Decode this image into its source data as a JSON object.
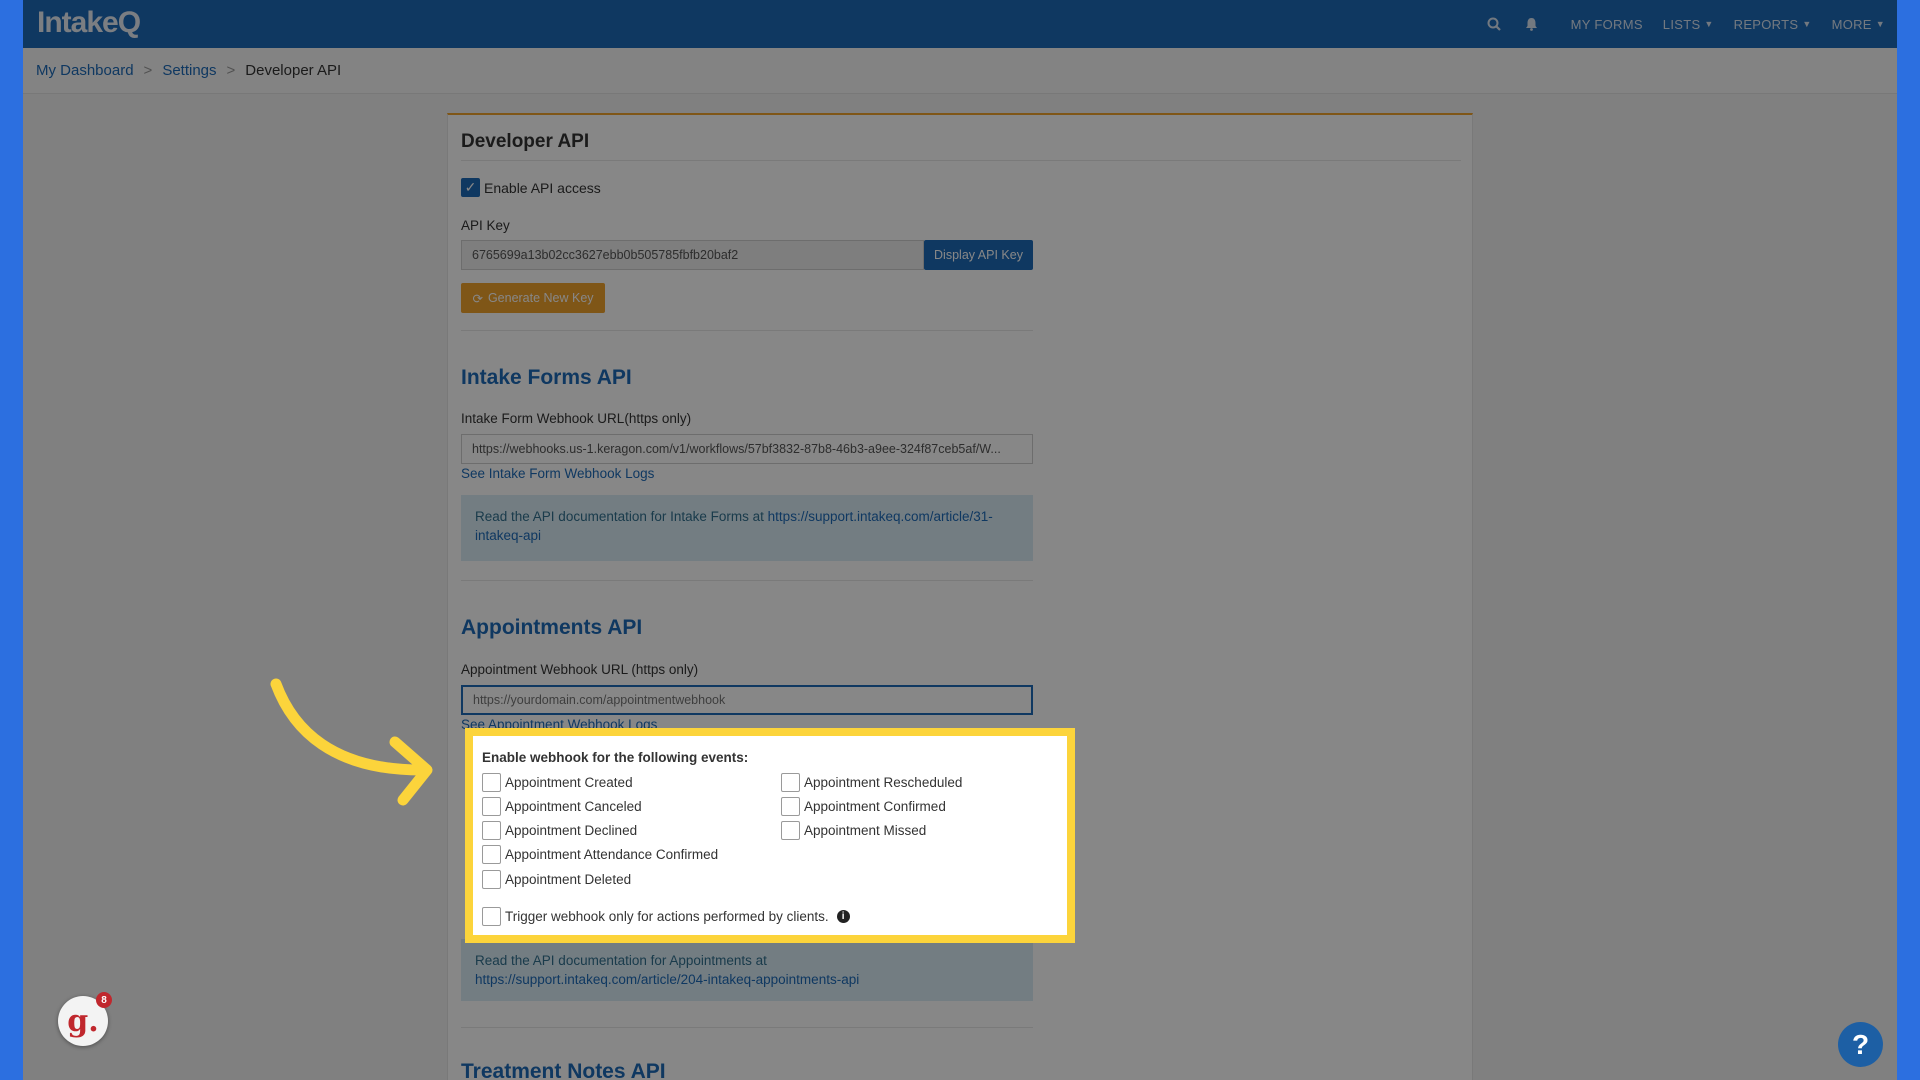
{
  "app": {
    "logo": "IntakeQ"
  },
  "nav": {
    "my_forms": "MY FORMS",
    "lists": "LISTS",
    "reports": "REPORTS",
    "more": "MORE"
  },
  "breadcrumb": {
    "dashboard": "My Dashboard",
    "settings": "Settings",
    "current": "Developer API",
    "separator": ">"
  },
  "developer_api": {
    "title": "Developer API",
    "enable_label": "Enable API access",
    "enable_checked": true,
    "api_key_label": "API Key",
    "api_key_value": "6765699a13b02cc3627ebb0b505785fbfb20baf2",
    "display_button": "Display API Key",
    "generate_button": "Generate New Key"
  },
  "intake_forms_api": {
    "title": "Intake Forms API",
    "webhook_label": "Intake Form Webhook URL(https only)",
    "webhook_value": "https://webhooks.us-1.keragon.com/v1/workflows/57bf3832-87b8-46b3-a9ee-324f87ceb5af/W...",
    "logs_link": "See Intake Form Webhook Logs",
    "doc_text": "Read the API documentation for Intake Forms at",
    "doc_url": "https://support.intakeq.com/article/31-intakeq-api"
  },
  "appointments_api": {
    "title": "Appointments API",
    "webhook_label": "Appointment Webhook URL (https only)",
    "webhook_placeholder": "https://yourdomain.com/appointmentwebhook",
    "logs_link": "See Appointment Webhook Logs",
    "events_title": "Enable webhook for the following events:",
    "events_left": [
      "Appointment Created",
      "Appointment Canceled",
      "Appointment Declined",
      "Appointment Attendance Confirmed",
      "Appointment Deleted"
    ],
    "events_right": [
      "Appointment Rescheduled",
      "Appointment Confirmed",
      "Appointment Missed"
    ],
    "client_only_label": "Trigger webhook only for actions performed by clients.",
    "doc_text": "Read the API documentation for Appointments at",
    "doc_url": "https://support.intakeq.com/article/204-intakeq-appointments-api"
  },
  "treatment_notes_api": {
    "title": "Treatment Notes API"
  },
  "widgets": {
    "badge_letter": "g.",
    "badge_count": "8",
    "help": "?"
  },
  "colors": {
    "brand": "#1d6ab8",
    "accent_orange": "#f0a22c",
    "highlight": "#fcd43b",
    "frame": "#2c6fe0"
  }
}
